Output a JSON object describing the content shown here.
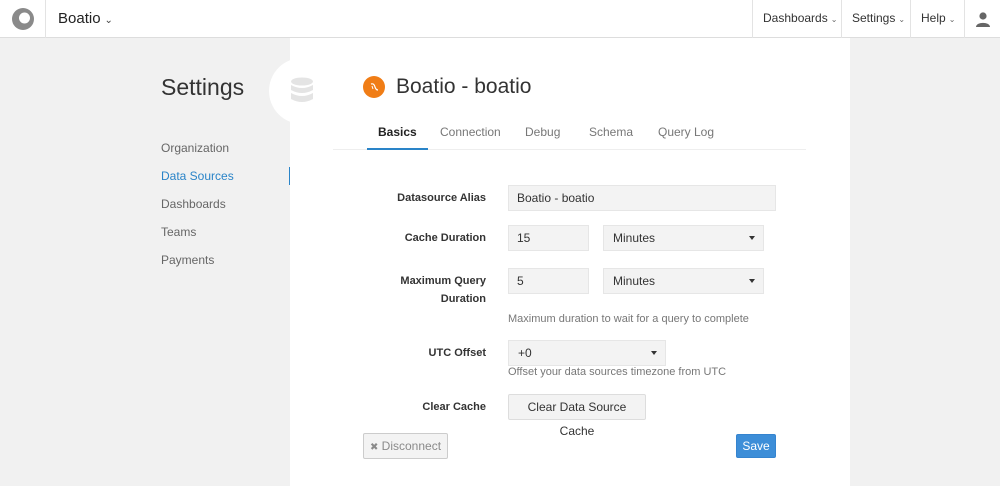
{
  "app": {
    "name": "Boatio"
  },
  "topnav": {
    "items": [
      {
        "label": "Dashboards"
      },
      {
        "label": "Settings"
      },
      {
        "label": "Help"
      }
    ]
  },
  "sidebar": {
    "title": "Settings",
    "items": [
      {
        "label": "Organization"
      },
      {
        "label": "Data Sources",
        "active": true
      },
      {
        "label": "Dashboards"
      },
      {
        "label": "Teams"
      },
      {
        "label": "Payments"
      }
    ]
  },
  "datasource": {
    "title": "Boatio - boatio",
    "icon_color": "#f07d16"
  },
  "tabs": [
    {
      "label": "Basics",
      "active": true
    },
    {
      "label": "Connection"
    },
    {
      "label": "Debug"
    },
    {
      "label": "Schema"
    },
    {
      "label": "Query Log"
    }
  ],
  "form": {
    "alias": {
      "label": "Datasource Alias",
      "value": "Boatio - boatio"
    },
    "cache_duration": {
      "label": "Cache Duration",
      "value": "15",
      "unit": "Minutes"
    },
    "max_query": {
      "label_line1": "Maximum Query",
      "label_line2": "Duration",
      "value": "5",
      "unit": "Minutes",
      "help": "Maximum duration to wait for a query to complete"
    },
    "utc_offset": {
      "label": "UTC Offset",
      "value": "+0",
      "help": "Offset your data sources timezone from UTC"
    },
    "clear_cache": {
      "label": "Clear Cache",
      "button": "Clear Data Source Cache"
    }
  },
  "actions": {
    "disconnect": "Disconnect",
    "save": "Save"
  },
  "colors": {
    "accent": "#2a84c8",
    "save": "#3d8ed8"
  }
}
